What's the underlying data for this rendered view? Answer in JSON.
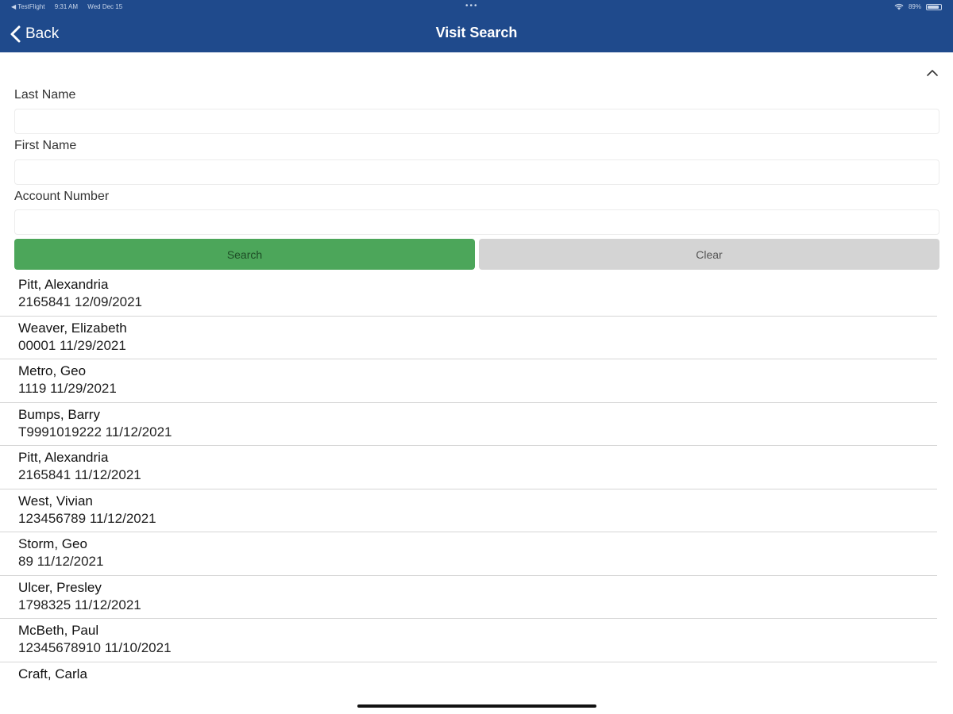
{
  "status_bar": {
    "carrier": "◀ TestFlight",
    "time": "9:31 AM",
    "date": "Wed Dec 15",
    "battery": "89%"
  },
  "nav": {
    "back_label": "Back",
    "title": "Visit Search"
  },
  "form": {
    "last_name_label": "Last Name",
    "last_name_value": "",
    "first_name_label": "First Name",
    "first_name_value": "",
    "account_label": "Account Number",
    "account_value": ""
  },
  "buttons": {
    "search": "Search",
    "clear": "Clear"
  },
  "results": [
    {
      "name": "Pitt, Alexandria",
      "detail": "2165841 12/09/2021"
    },
    {
      "name": "Weaver, Elizabeth",
      "detail": "00001 11/29/2021"
    },
    {
      "name": "Metro, Geo",
      "detail": "1119 11/29/2021"
    },
    {
      "name": "Bumps, Barry",
      "detail": "T9991019222 11/12/2021"
    },
    {
      "name": "Pitt, Alexandria",
      "detail": "2165841 11/12/2021"
    },
    {
      "name": "West, Vivian",
      "detail": "123456789 11/12/2021"
    },
    {
      "name": "Storm, Geo",
      "detail": "89 11/12/2021"
    },
    {
      "name": "Ulcer, Presley",
      "detail": "1798325 11/12/2021"
    },
    {
      "name": "McBeth, Paul",
      "detail": "12345678910 11/10/2021"
    },
    {
      "name": "Craft, Carla",
      "detail": ""
    }
  ],
  "colors": {
    "navbar": "#1f4a8c",
    "search_button": "#4ca65a",
    "clear_button": "#d4d4d4"
  },
  "icons": [
    "back-chevron-icon",
    "collapse-chevron-up-icon",
    "wifi-icon",
    "battery-icon"
  ]
}
